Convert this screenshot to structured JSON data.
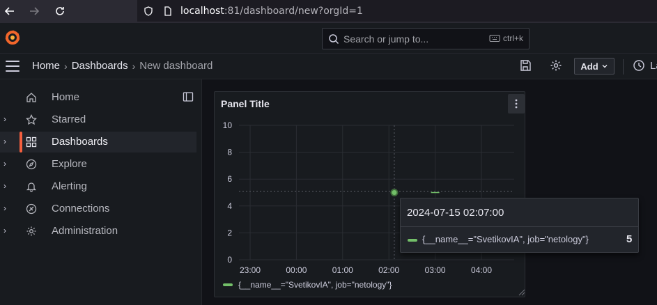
{
  "browser": {
    "url_host": "localhost",
    "url_rest": ":81/dashboard/new?orgId=1"
  },
  "topbar": {
    "search_placeholder": "Search or jump to...",
    "shortcut": "ctrl+k"
  },
  "breadcrumb": {
    "items": [
      "Home",
      "Dashboards",
      "New dashboard"
    ],
    "add_label": "Add",
    "last_label": "La"
  },
  "sidebar": {
    "items": [
      {
        "label": "Home",
        "icon": "home-icon",
        "expandable": false,
        "active": false
      },
      {
        "label": "Starred",
        "icon": "star-icon",
        "expandable": true,
        "active": false
      },
      {
        "label": "Dashboards",
        "icon": "dashboards-icon",
        "expandable": true,
        "active": true
      },
      {
        "label": "Explore",
        "icon": "compass-icon",
        "expandable": true,
        "active": false
      },
      {
        "label": "Alerting",
        "icon": "bell-icon",
        "expandable": true,
        "active": false
      },
      {
        "label": "Connections",
        "icon": "connections-icon",
        "expandable": true,
        "active": false
      },
      {
        "label": "Administration",
        "icon": "gear-icon",
        "expandable": true,
        "active": false
      }
    ]
  },
  "panel": {
    "title": "Panel Title"
  },
  "chart_data": {
    "type": "line",
    "title": "Panel Title",
    "y_ticks": [
      "10",
      "8",
      "6",
      "4",
      "2",
      "0"
    ],
    "x_ticks": [
      "23:00",
      "00:00",
      "01:00",
      "02:00",
      "03:00",
      "04:00"
    ],
    "ylim": [
      0,
      10
    ],
    "grid": true,
    "series": [
      {
        "name": "{__name__=\"SvetikovIA\", job=\"netology\"}",
        "color": "#73bf69",
        "points": [
          {
            "x": "02:07",
            "y": 5
          },
          {
            "x": "03:00",
            "y": 5
          }
        ]
      }
    ],
    "legend": "bottom-left"
  },
  "tooltip": {
    "time": "2024-07-15 02:07:00",
    "series": "{__name__=\"SvetikovIA\", job=\"netology\"}",
    "value": "5"
  },
  "colors": {
    "accent": "#f55f3e",
    "series": "#73bf69"
  }
}
